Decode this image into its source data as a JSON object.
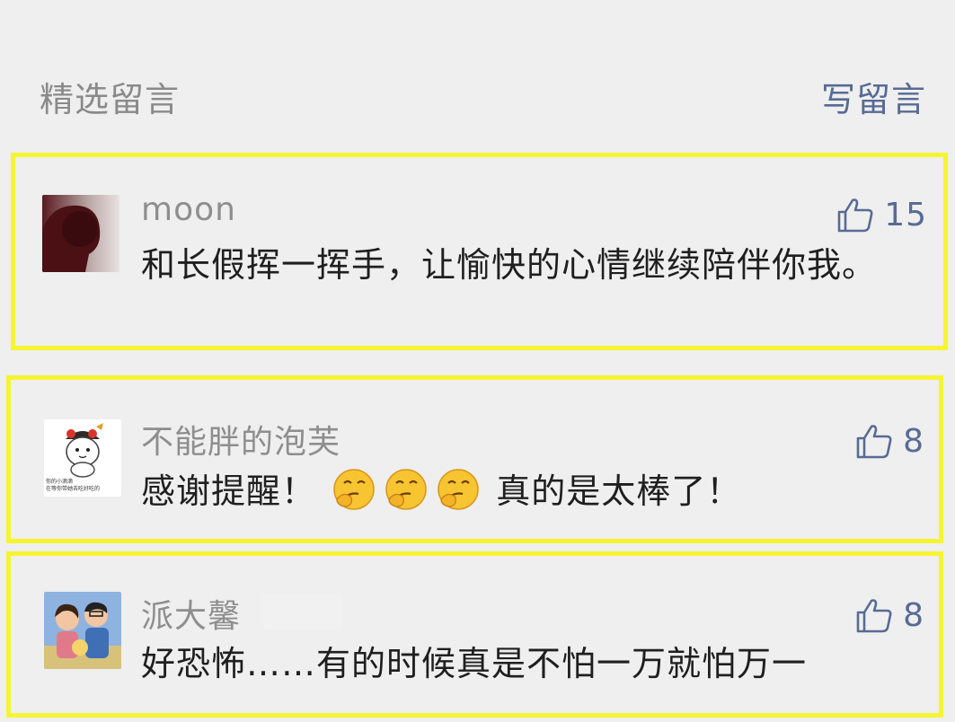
{
  "header": {
    "title": "精选留言",
    "write_label": "写留言"
  },
  "comments": [
    {
      "nickname": "moon",
      "content": "和长假挥一挥手，让愉快的心情继续陪伴你我。",
      "likes": "15",
      "avatar_icon": "person-silhouette-avatar"
    },
    {
      "nickname": "不能胖的泡芙",
      "content_before": "感谢提醒！",
      "emoji": "thinking-face-emoji",
      "content_after": "真的是太棒了！",
      "likes": "8",
      "avatar_icon": "cartoon-character-avatar",
      "avatar_text_line1": "你的小滴滴",
      "avatar_text_line2": "在等你带她去吃好吃的"
    },
    {
      "nickname": "派大馨",
      "content": "好恐怖……有的时候真是不怕一万就怕万一",
      "likes": "8",
      "avatar_icon": "cartoon-couple-avatar"
    }
  ],
  "colors": {
    "background": "#efefef",
    "highlight_border": "#f5f532",
    "link_blue": "#576b95",
    "nickname_gray": "#8e8e8e",
    "text_dark": "#1f1f1f"
  }
}
